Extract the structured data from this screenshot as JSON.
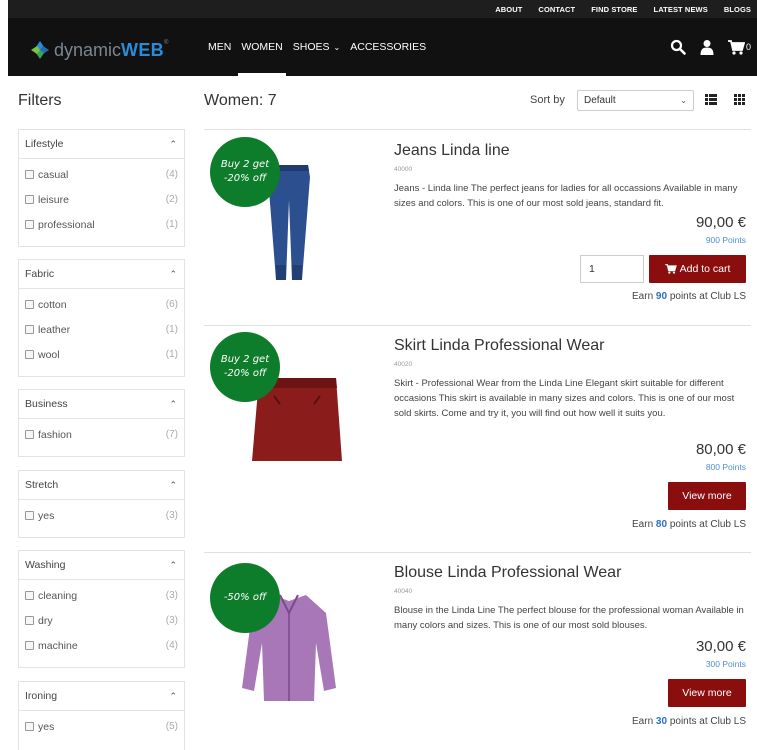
{
  "topbar": {
    "links": [
      "ABOUT",
      "CONTACT",
      "FIND STORE",
      "LATEST NEWS",
      "BLOGS"
    ]
  },
  "header": {
    "logo_part1": "dynamic",
    "logo_part2": "WEB",
    "logo_reg": "®",
    "nav": [
      {
        "label": "MEN"
      },
      {
        "label": "WOMEN"
      },
      {
        "label": "SHOES"
      },
      {
        "label": "ACCESSORIES"
      }
    ],
    "cart_count": "0"
  },
  "filters": {
    "title": "Filters",
    "groups": [
      {
        "name": "Lifestyle",
        "options": [
          {
            "label": "casual",
            "count": "(4)"
          },
          {
            "label": "leisure",
            "count": "(2)"
          },
          {
            "label": "professional",
            "count": "(1)"
          }
        ]
      },
      {
        "name": "Fabric",
        "options": [
          {
            "label": "cotton",
            "count": "(6)"
          },
          {
            "label": "leather",
            "count": "(1)"
          },
          {
            "label": "wool",
            "count": "(1)"
          }
        ]
      },
      {
        "name": "Business",
        "options": [
          {
            "label": "fashion",
            "count": "(7)"
          }
        ]
      },
      {
        "name": "Stretch",
        "options": [
          {
            "label": "yes",
            "count": "(3)"
          }
        ]
      },
      {
        "name": "Washing",
        "options": [
          {
            "label": "cleaning",
            "count": "(3)"
          },
          {
            "label": "dry",
            "count": "(3)"
          },
          {
            "label": "machine",
            "count": "(4)"
          }
        ]
      },
      {
        "name": "Ironing",
        "options": [
          {
            "label": "yes",
            "count": "(5)"
          }
        ]
      }
    ]
  },
  "results": {
    "title": "Women: 7",
    "sort_label": "Sort by",
    "sort_value": "Default"
  },
  "products": [
    {
      "badge_line1": "Buy 2 get",
      "badge_line2": "-20% off",
      "name": "Jeans Linda line",
      "number": "40000",
      "description": "Jeans - Linda line The perfect jeans for ladies for all occassions Available in many sizes and colors. This is one of our most sold jeans, standard fit.",
      "price": "90,00 €",
      "points": "900 Points",
      "quantity": "1",
      "button": "Add to cart",
      "earn_prefix": "Earn",
      "earn_points": "90",
      "earn_suffix": "points at Club LS"
    },
    {
      "badge_line1": "Buy 2 get",
      "badge_line2": "-20% off",
      "name": "Skirt Linda Professional Wear",
      "number": "40020",
      "description": "Skirt - Professional Wear from the Linda Line Elegant skirt suitable for different occasions This skirt is available in many sizes and colors. This is one of our most sold skirts. Come and try it, you will find out how well it suits you.",
      "price": "80,00 €",
      "points": "800 Points",
      "button": "View more",
      "earn_prefix": "Earn",
      "earn_points": "80",
      "earn_suffix": "points at Club LS"
    },
    {
      "badge_line1": "-50% off",
      "name": "Blouse Linda Professional Wear",
      "number": "40040",
      "description": "Blouse in the Linda Line The perfect blouse for the professional woman Available in many colors and sizes. This is one of our most sold blouses.",
      "price": "30,00 €",
      "points": "300 Points",
      "button": "View more",
      "earn_prefix": "Earn",
      "earn_points": "30",
      "earn_suffix": "points at Club LS"
    }
  ],
  "colors": {
    "topbar_bg": "#1e1e1e",
    "header_bg": "#111111",
    "badge_green": "#0d7d2b",
    "button_red": "#8b0e0e",
    "points_blue": "#4f8fd6",
    "logo_blue": "#2b8bd6"
  },
  "icons": {
    "search": "search-icon",
    "user": "user-icon",
    "cart": "cart-icon",
    "list_view": "list-view-icon",
    "grid_view": "grid-view-icon"
  }
}
